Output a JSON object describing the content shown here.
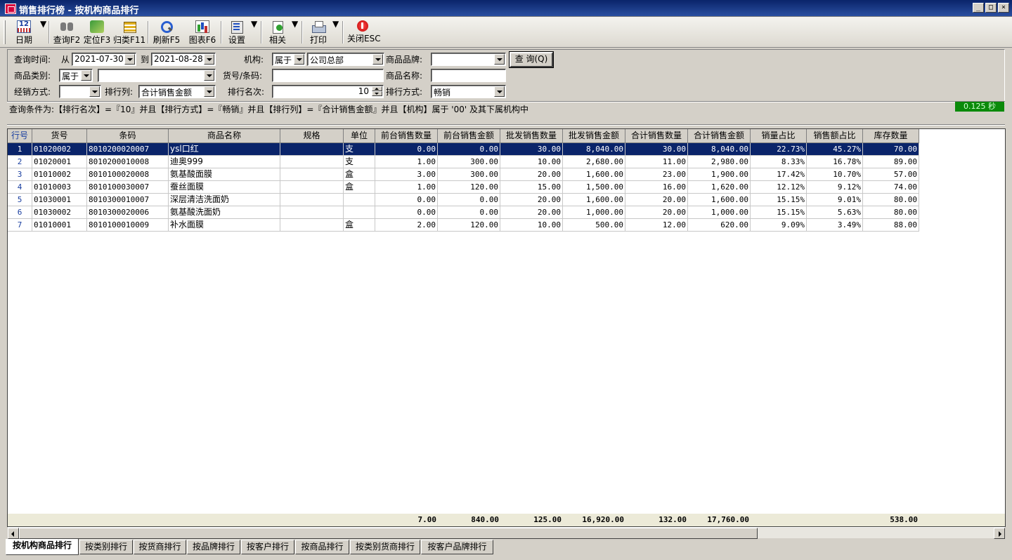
{
  "window": {
    "title": "销售排行榜 - 按机构商品排行",
    "minimize": "_",
    "maximize": "□",
    "close": "×"
  },
  "toolbar": {
    "items": [
      {
        "label": "日期",
        "icon": "calendar-icon"
      },
      {
        "label": "查询F2",
        "icon": "binoculars-icon"
      },
      {
        "label": "定位F3",
        "icon": "locate-icon"
      },
      {
        "label": "归类F11",
        "icon": "category-icon"
      },
      {
        "label": "刷新F5",
        "icon": "refresh-icon"
      },
      {
        "label": "图表F6",
        "icon": "chart-icon"
      },
      {
        "label": "设置",
        "icon": "settings-icon"
      },
      {
        "label": "相关",
        "icon": "related-icon"
      },
      {
        "label": "打印",
        "icon": "print-icon"
      },
      {
        "label": "关闭ESC",
        "icon": "close-icon"
      }
    ]
  },
  "query": {
    "time_label": "查询时间:",
    "from_label": "从",
    "from_date": "2021-07-30",
    "to_label": "到",
    "to_date": "2021-08-28",
    "org_label": "机构:",
    "org_relation": "属于",
    "org_value": "公司总部",
    "brand_label": "商品品牌:",
    "brand_value": "",
    "query_button": "查 询(Q)",
    "category_label": "商品类别:",
    "category_relation": "属于",
    "category_value": "",
    "code_label": "货号/条码:",
    "code_value": "",
    "name_label": "商品名称:",
    "name_value": "",
    "dist_label": "经销方式:",
    "dist_value": "",
    "rank_col_label": "排行列:",
    "rank_col_value": "合计销售金额",
    "rank_count_label": "排行名次:",
    "rank_count_value": "10",
    "rank_mode_label": "排行方式:",
    "rank_mode_value": "畅销"
  },
  "condition_text": "查询条件为:【排行名次】=『10』并且【排行方式】=『畅销』并且【排行列】=『合计销售金额』并且【机构】属于 '00' 及其下属机构中",
  "elapsed": "0.125 秒",
  "table": {
    "columns": [
      "行号",
      "货号",
      "条码",
      "商品名称",
      "规格",
      "单位",
      "前台销售数量",
      "前台销售金额",
      "批发销售数量",
      "批发销售金额",
      "合计销售数量",
      "合计销售金额",
      "销量占比",
      "销售额占比",
      "库存数量"
    ],
    "rows": [
      [
        "1",
        "01020002",
        "8010200020007",
        "ysl口红",
        "",
        "支",
        "0.00",
        "0.00",
        "30.00",
        "8,040.00",
        "30.00",
        "8,040.00",
        "22.73%",
        "45.27%",
        "70.00"
      ],
      [
        "2",
        "01020001",
        "8010200010008",
        "迪奥999",
        "",
        "支",
        "1.00",
        "300.00",
        "10.00",
        "2,680.00",
        "11.00",
        "2,980.00",
        "8.33%",
        "16.78%",
        "89.00"
      ],
      [
        "3",
        "01010002",
        "8010100020008",
        "氨基酸面膜",
        "",
        "盒",
        "3.00",
        "300.00",
        "20.00",
        "1,600.00",
        "23.00",
        "1,900.00",
        "17.42%",
        "10.70%",
        "57.00"
      ],
      [
        "4",
        "01010003",
        "8010100030007",
        "蚕丝面膜",
        "",
        "盒",
        "1.00",
        "120.00",
        "15.00",
        "1,500.00",
        "16.00",
        "1,620.00",
        "12.12%",
        "9.12%",
        "74.00"
      ],
      [
        "5",
        "01030001",
        "8010300010007",
        "深层清洁洗面奶",
        "",
        "",
        "0.00",
        "0.00",
        "20.00",
        "1,600.00",
        "20.00",
        "1,600.00",
        "15.15%",
        "9.01%",
        "80.00"
      ],
      [
        "6",
        "01030002",
        "8010300020006",
        "氨基酸洗面奶",
        "",
        "",
        "0.00",
        "0.00",
        "20.00",
        "1,000.00",
        "20.00",
        "1,000.00",
        "15.15%",
        "5.63%",
        "80.00"
      ],
      [
        "7",
        "01010001",
        "8010100010009",
        "补水面膜",
        "",
        "盒",
        "2.00",
        "120.00",
        "10.00",
        "500.00",
        "12.00",
        "620.00",
        "9.09%",
        "3.49%",
        "88.00"
      ]
    ],
    "selected_row": 0,
    "totals": {
      "front_qty": "7.00",
      "front_amt": "840.00",
      "whole_qty": "125.00",
      "whole_amt": "16,920.00",
      "total_qty": "132.00",
      "total_amt": "17,760.00",
      "stock": "538.00"
    }
  },
  "tabs": [
    "按机构商品排行",
    "按类别排行",
    "按货商排行",
    "按品牌排行",
    "按客户排行",
    "按商品排行",
    "按类别货商排行",
    "按客户品牌排行"
  ],
  "active_tab": 0
}
